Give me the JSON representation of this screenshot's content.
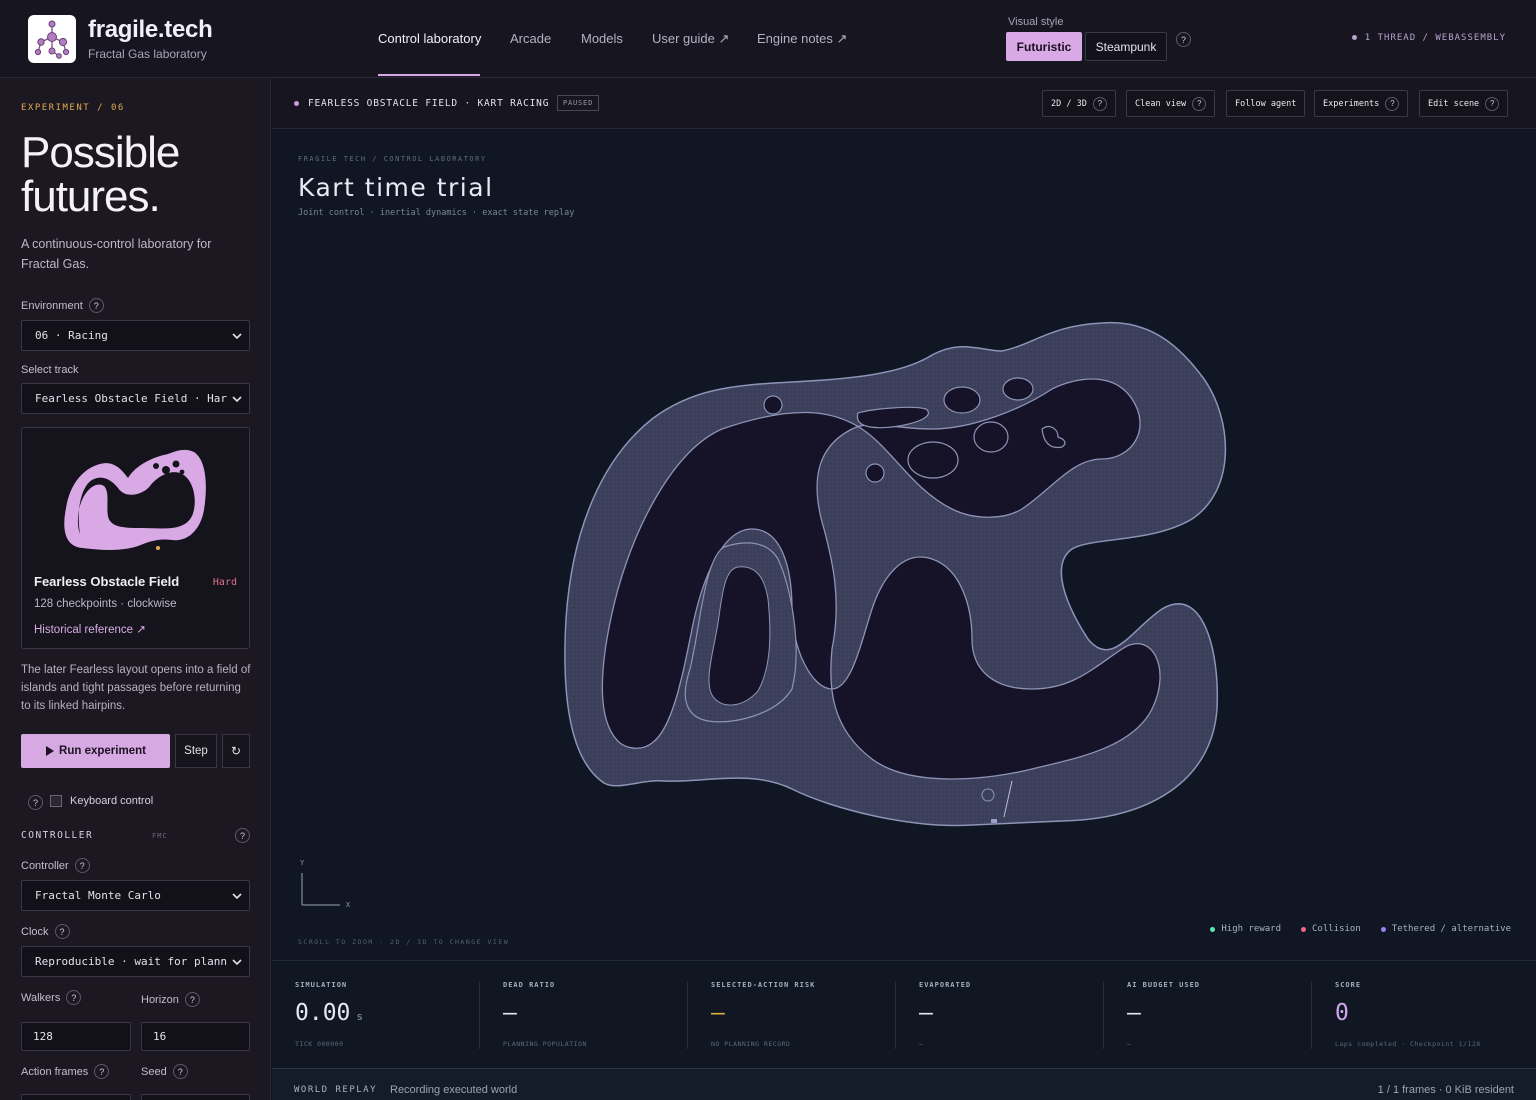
{
  "brand": {
    "name": "fragile.tech",
    "subtitle": "Fractal Gas laboratory"
  },
  "nav": [
    {
      "label": "Control laboratory",
      "active": true
    },
    {
      "label": "Arcade"
    },
    {
      "label": "Models"
    },
    {
      "label": "User guide ↗"
    },
    {
      "label": "Engine notes ↗"
    }
  ],
  "visual_style": {
    "label": "Visual style",
    "options": [
      "Futuristic",
      "Steampunk"
    ],
    "selected": "Futuristic",
    "help": "?"
  },
  "thread_info": "1 THREAD / WEBASSEMBLY",
  "sidebar": {
    "experiment_label": "EXPERIMENT / 06",
    "title_line1": "Possible",
    "title_line2": "futures.",
    "description": "A continuous-control laboratory for Fractal Gas.",
    "environment_label": "Environment",
    "environment_value": "06 · Racing",
    "track_label": "Select track",
    "track_value": "Fearless Obstacle Field · Har",
    "track_card": {
      "name": "Fearless Obstacle Field",
      "difficulty": "Hard",
      "meta": "128 checkpoints · clockwise",
      "reference": "Historical reference ↗"
    },
    "track_description": "The later Fearless layout opens into a field of islands and tight passages before returning to its linked hairpins.",
    "run_button": "Run experiment",
    "step_button": "Step",
    "reset_icon": "↻",
    "keyboard_label": "Keyboard control",
    "keyboard_checked": false,
    "controller_heading": "CONTROLLER",
    "controller_tag": "FMC",
    "controller_label": "Controller",
    "controller_value": "Fractal Monte Carlo",
    "clock_label": "Clock",
    "clock_value": "Reproducible · wait for plann",
    "walkers_label": "Walkers",
    "walkers_value": "128",
    "horizon_label": "Horizon",
    "horizon_value": "16",
    "action_frames_label": "Action frames",
    "seed_label": "Seed"
  },
  "topbar": {
    "run_title": "FEARLESS OBSTACLE FIELD · KART RACING",
    "status": "PAUSED",
    "buttons": [
      "2D / 3D",
      "Clean view",
      "Follow agent",
      "Experiments",
      "Edit scene"
    ]
  },
  "scene": {
    "breadcrumb": "FRAGILE TECH / CONTROL LABORATORY",
    "title": "Kart time trial",
    "subtitle": "Joint control · inertial dynamics · exact state replay",
    "axis_y": "Y",
    "axis_x": "X",
    "hint": "SCROLL TO ZOOM · 2D / 3D TO CHANGE VIEW",
    "legend": [
      {
        "label": "High reward",
        "color": "#5ee6b0"
      },
      {
        "label": "Collision",
        "color": "#f0668f"
      },
      {
        "label": "Tethered / alternative",
        "color": "#9b82f0"
      }
    ]
  },
  "stats": [
    {
      "label": "SIMULATION",
      "value": "0.00",
      "unit": "s",
      "note": "TICK 000000"
    },
    {
      "label": "DEAD RATIO",
      "value": "—",
      "note": "PLANNING POPULATION"
    },
    {
      "label": "SELECTED-ACTION RISK",
      "value": "—",
      "note": "NO PLANNING RECORD",
      "accent": "#e0b040"
    },
    {
      "label": "EVAPORATED",
      "value": "—",
      "note": "—"
    },
    {
      "label": "AI BUDGET USED",
      "value": "—",
      "note": "—"
    },
    {
      "label": "SCORE",
      "value": "0",
      "note": "Laps completed · Checkpoint 1/128",
      "accent": "#cda7e8"
    }
  ],
  "replay": {
    "label": "WORLD REPLAY",
    "status": "Recording executed world",
    "frames": "1 / 1 frames · 0 KiB resident"
  },
  "colors": {
    "accent": "#d8a9e4",
    "track_fill": "#3a3d58",
    "track_edge": "#8a90b0",
    "warning": "#e0a94e",
    "hard": "#e0718e"
  }
}
